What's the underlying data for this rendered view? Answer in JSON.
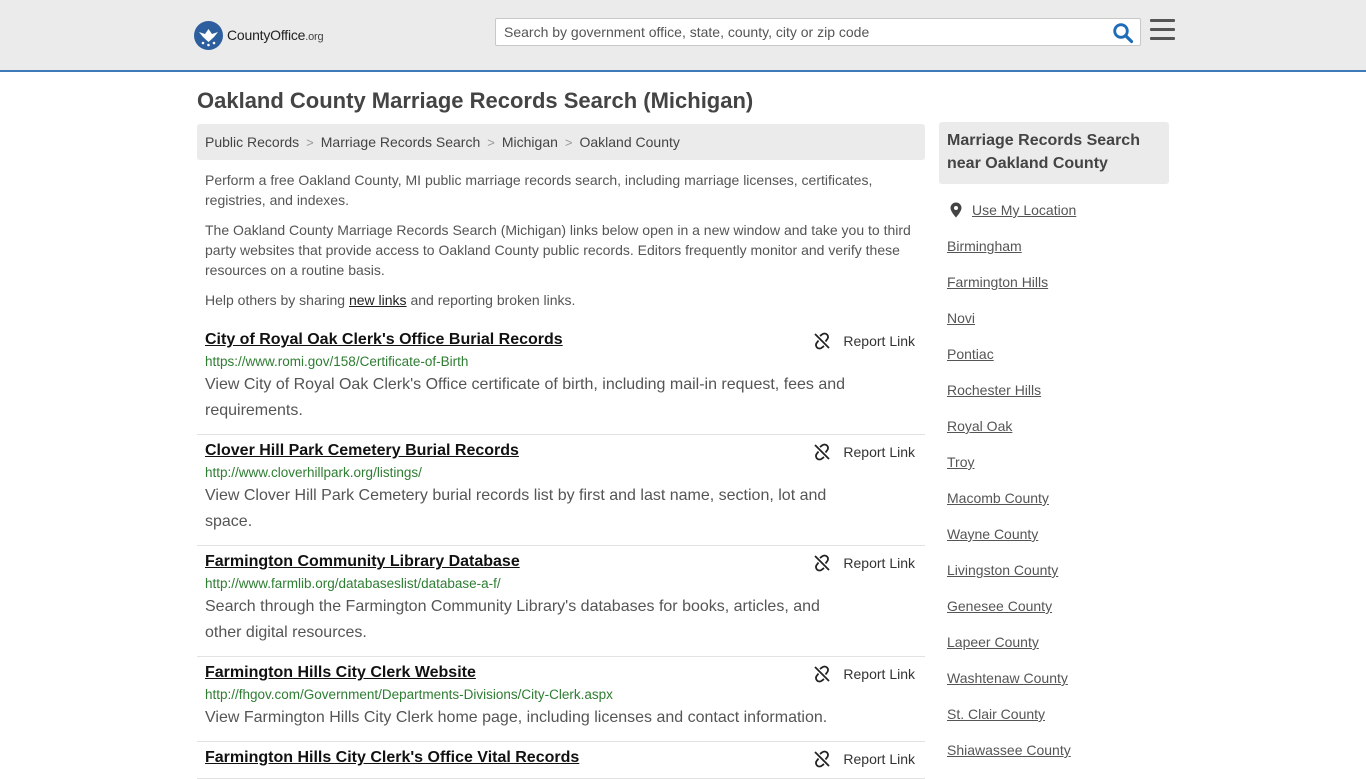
{
  "header": {
    "logo_text": "CountyOffice",
    "logo_suffix": ".org",
    "search_placeholder": "Search by government office, state, county, city or zip code"
  },
  "page_title": "Oakland County Marriage Records Search (Michigan)",
  "breadcrumb": [
    "Public Records",
    "Marriage Records Search",
    "Michigan",
    "Oakland County"
  ],
  "intro": {
    "p1": "Perform a free Oakland County, MI public marriage records search, including marriage licenses, certificates, registries, and indexes.",
    "p2": "The Oakland County Marriage Records Search (Michigan) links below open in a new window and take you to third party websites that provide access to Oakland County public records. Editors frequently monitor and verify these resources on a routine basis.",
    "p3_prefix": "Help others by sharing ",
    "p3_link": "new links",
    "p3_suffix": " and reporting broken links."
  },
  "report_label": "Report Link",
  "results": [
    {
      "title": "City of Royal Oak Clerk's Office Burial Records",
      "url": "https://www.romi.gov/158/Certificate-of-Birth",
      "desc": "View City of Royal Oak Clerk's Office certificate of birth, including mail-in request, fees and requirements."
    },
    {
      "title": "Clover Hill Park Cemetery Burial Records",
      "url": "http://www.cloverhillpark.org/listings/",
      "desc": "View Clover Hill Park Cemetery burial records list by first and last name, section, lot and space."
    },
    {
      "title": "Farmington Community Library Database",
      "url": "http://www.farmlib.org/databaseslist/database-a-f/",
      "desc": "Search through the Farmington Community Library's databases for books, articles, and other digital resources."
    },
    {
      "title": "Farmington Hills City Clerk Website",
      "url": "http://fhgov.com/Government/Departments-Divisions/City-Clerk.aspx",
      "desc": "View Farmington Hills City Clerk home page, including licenses and contact information."
    },
    {
      "title": "Farmington Hills City Clerk's Office Vital Records",
      "url": "",
      "desc": ""
    }
  ],
  "sidebar": {
    "heading": "Marriage Records Search near Oakland County",
    "use_location": "Use My Location",
    "items": [
      "Birmingham",
      "Farmington Hills",
      "Novi",
      "Pontiac",
      "Rochester Hills",
      "Royal Oak",
      "Troy",
      "Macomb County",
      "Wayne County",
      "Livingston County",
      "Genesee County",
      "Lapeer County",
      "Washtenaw County",
      "St. Clair County",
      "Shiawassee County"
    ]
  },
  "colors": {
    "header_bg": "#ebebeb",
    "header_border": "#3d7ab8",
    "logo_blue": "#2d5f9e",
    "search_icon": "#1e6bb8",
    "url_green": "#2e7d32"
  }
}
